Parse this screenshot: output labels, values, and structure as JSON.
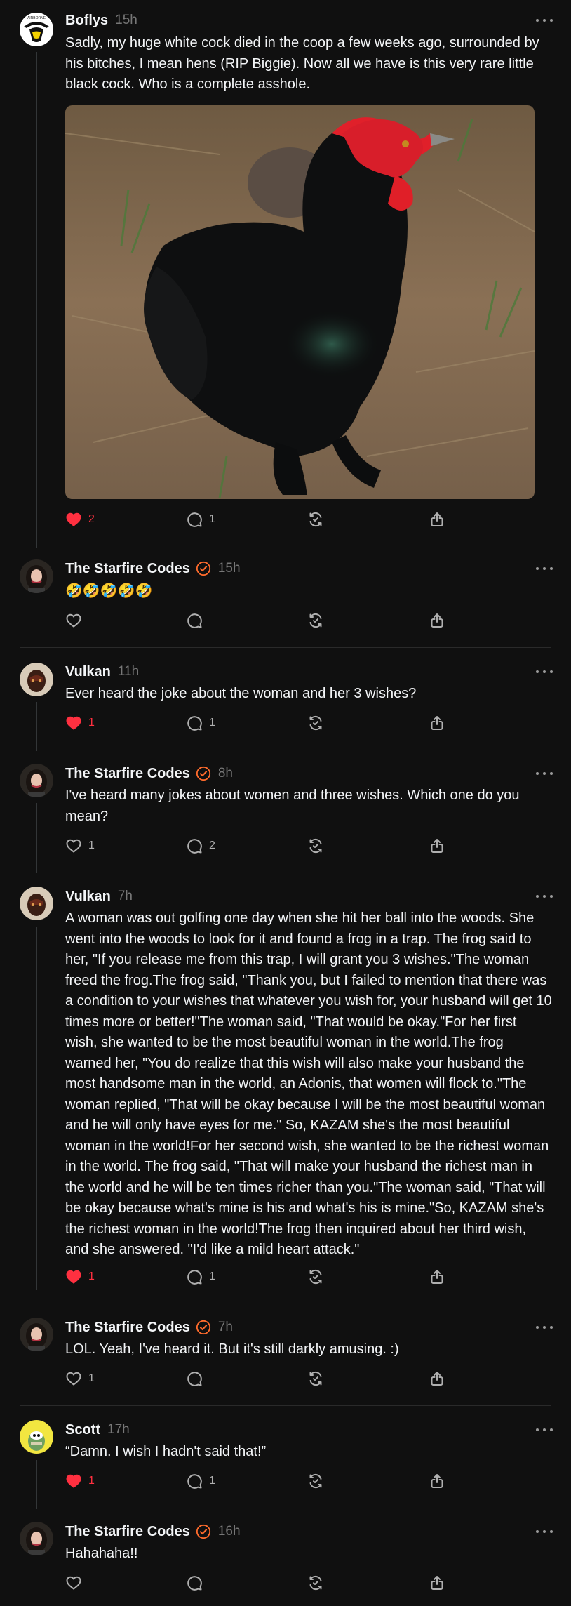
{
  "posts": [
    {
      "username": "Boflys",
      "time": "15h",
      "verified": false,
      "text": "Sadly, my huge white cock died in the coop a few weeks ago, surrounded by his bitches, I mean hens (RIP Biggie). Now all we have is this very rare little black cock. Who is a complete asshole.",
      "likes": "2",
      "liked": true,
      "replies": "1",
      "image": "black-rooster-photo"
    },
    {
      "username": "The Starfire Codes",
      "time": "15h",
      "verified": true,
      "text": "🤣🤣🤣🤣🤣",
      "likes": "",
      "liked": false,
      "replies": ""
    },
    {
      "username": "Vulkan",
      "time": "11h",
      "verified": false,
      "text": "Ever heard the joke about the woman and her 3 wishes?",
      "likes": "1",
      "liked": true,
      "replies": "1"
    },
    {
      "username": "The Starfire Codes",
      "time": "8h",
      "verified": true,
      "text": "I've heard many jokes about women and three wishes. Which one do you mean?",
      "likes": "1",
      "liked": false,
      "replies": "2"
    },
    {
      "username": "Vulkan",
      "time": "7h",
      "verified": false,
      "text": "A woman was out golfing one day when she hit her ball into the woods. She went into the woods to look for it and found a frog in a trap. The frog said to her, \"If you release me from this trap, I will grant you 3 wishes.\"The woman freed the frog.The frog said, \"Thank you, but I failed to mention that there was a condition to your wishes that whatever you wish for, your husband will get 10 times more or better!\"The woman said, \"That would be okay.\"For her first wish, she wanted to be the most beautiful woman in the world.The frog warned her, \"You do realize that this wish will also make your husband the most handsome man in the world, an Adonis, that women will flock to.\"The woman replied, \"That will be okay because I will be the most beautiful woman and he will only have eyes for me.\" So, KAZAM she's the most beautiful woman in the world!For her second wish, she wanted to be the richest woman in the world. The frog said, \"That will make your husband the richest man in the world and he will be ten times richer than you.\"The woman said, \"That will be okay because what's mine is his and what's his is mine.\"So, KAZAM she's the richest woman in the world!The frog then inquired about her third wish, and she answered. \"I'd like a mild heart attack.\"",
      "likes": "1",
      "liked": true,
      "replies": "1"
    },
    {
      "username": "The Starfire Codes",
      "time": "7h",
      "verified": true,
      "text": "LOL. Yeah, I've heard it. But it's still darkly amusing. :)",
      "likes": "1",
      "liked": false,
      "replies": ""
    },
    {
      "username": "Scott",
      "time": "17h",
      "verified": false,
      "text": "“Damn. I wish I hadn't said that!”",
      "likes": "1",
      "liked": true,
      "replies": "1"
    },
    {
      "username": "The Starfire Codes",
      "time": "16h",
      "verified": true,
      "text": "Hahahaha!!",
      "likes": "",
      "liked": false,
      "replies": ""
    }
  ],
  "icons": [
    "heart-icon",
    "comment-icon",
    "repost-icon",
    "share-icon",
    "more-icon",
    "verified-icon"
  ],
  "colors": {
    "background": "#101010",
    "liked": "#ff3040",
    "verified": "#ff6b2c",
    "muted": "#777777"
  }
}
